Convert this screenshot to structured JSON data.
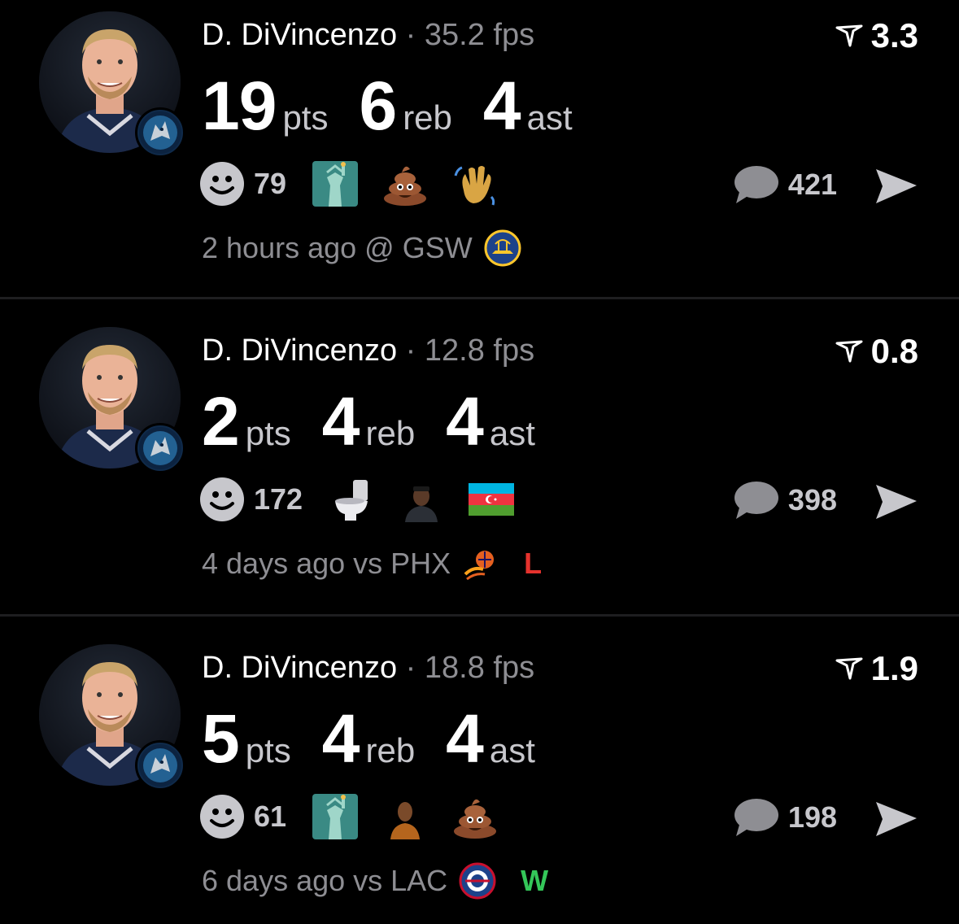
{
  "posts": [
    {
      "player_name": "D. DiVincenzo",
      "separator": "·",
      "fps": "35.2 fps",
      "score": "3.3",
      "stats": [
        {
          "value": "19",
          "unit": "pts"
        },
        {
          "value": "6",
          "unit": "reb"
        },
        {
          "value": "4",
          "unit": "ast"
        }
      ],
      "reaction_count": "79",
      "reaction_icons": [
        "statue-of-liberty-emoji",
        "poop-emoji",
        "waving-hand-emoji"
      ],
      "comment_count": "421",
      "time_opponent": "2 hours ago @ GSW",
      "opponent_logo": "warriors-logo",
      "result": "",
      "result_color": ""
    },
    {
      "player_name": "D. DiVincenzo",
      "separator": "·",
      "fps": "12.8 fps",
      "score": "0.8",
      "stats": [
        {
          "value": "2",
          "unit": "pts"
        },
        {
          "value": "4",
          "unit": "reb"
        },
        {
          "value": "4",
          "unit": "ast"
        }
      ],
      "reaction_count": "172",
      "reaction_icons": [
        "toilet-emoji",
        "person-photo-emoji",
        "azerbaijan-flag-emoji"
      ],
      "comment_count": "398",
      "time_opponent": "4 days ago vs PHX",
      "opponent_logo": "suns-logo",
      "result": "L",
      "result_color": "#e5322d"
    },
    {
      "player_name": "D. DiVincenzo",
      "separator": "·",
      "fps": "18.8 fps",
      "score": "1.9",
      "stats": [
        {
          "value": "5",
          "unit": "pts"
        },
        {
          "value": "4",
          "unit": "reb"
        },
        {
          "value": "4",
          "unit": "ast"
        }
      ],
      "reaction_count": "61",
      "reaction_icons": [
        "statue-of-liberty-emoji",
        "person-photo-emoji",
        "poop-emoji"
      ],
      "comment_count": "198",
      "time_opponent": "6 days ago vs LAC",
      "opponent_logo": "clippers-logo",
      "result": "W",
      "result_color": "#34c759"
    }
  ],
  "colors": {
    "background": "#000000",
    "secondary_text": "#8e8e93",
    "divider": "#1e1e20"
  }
}
